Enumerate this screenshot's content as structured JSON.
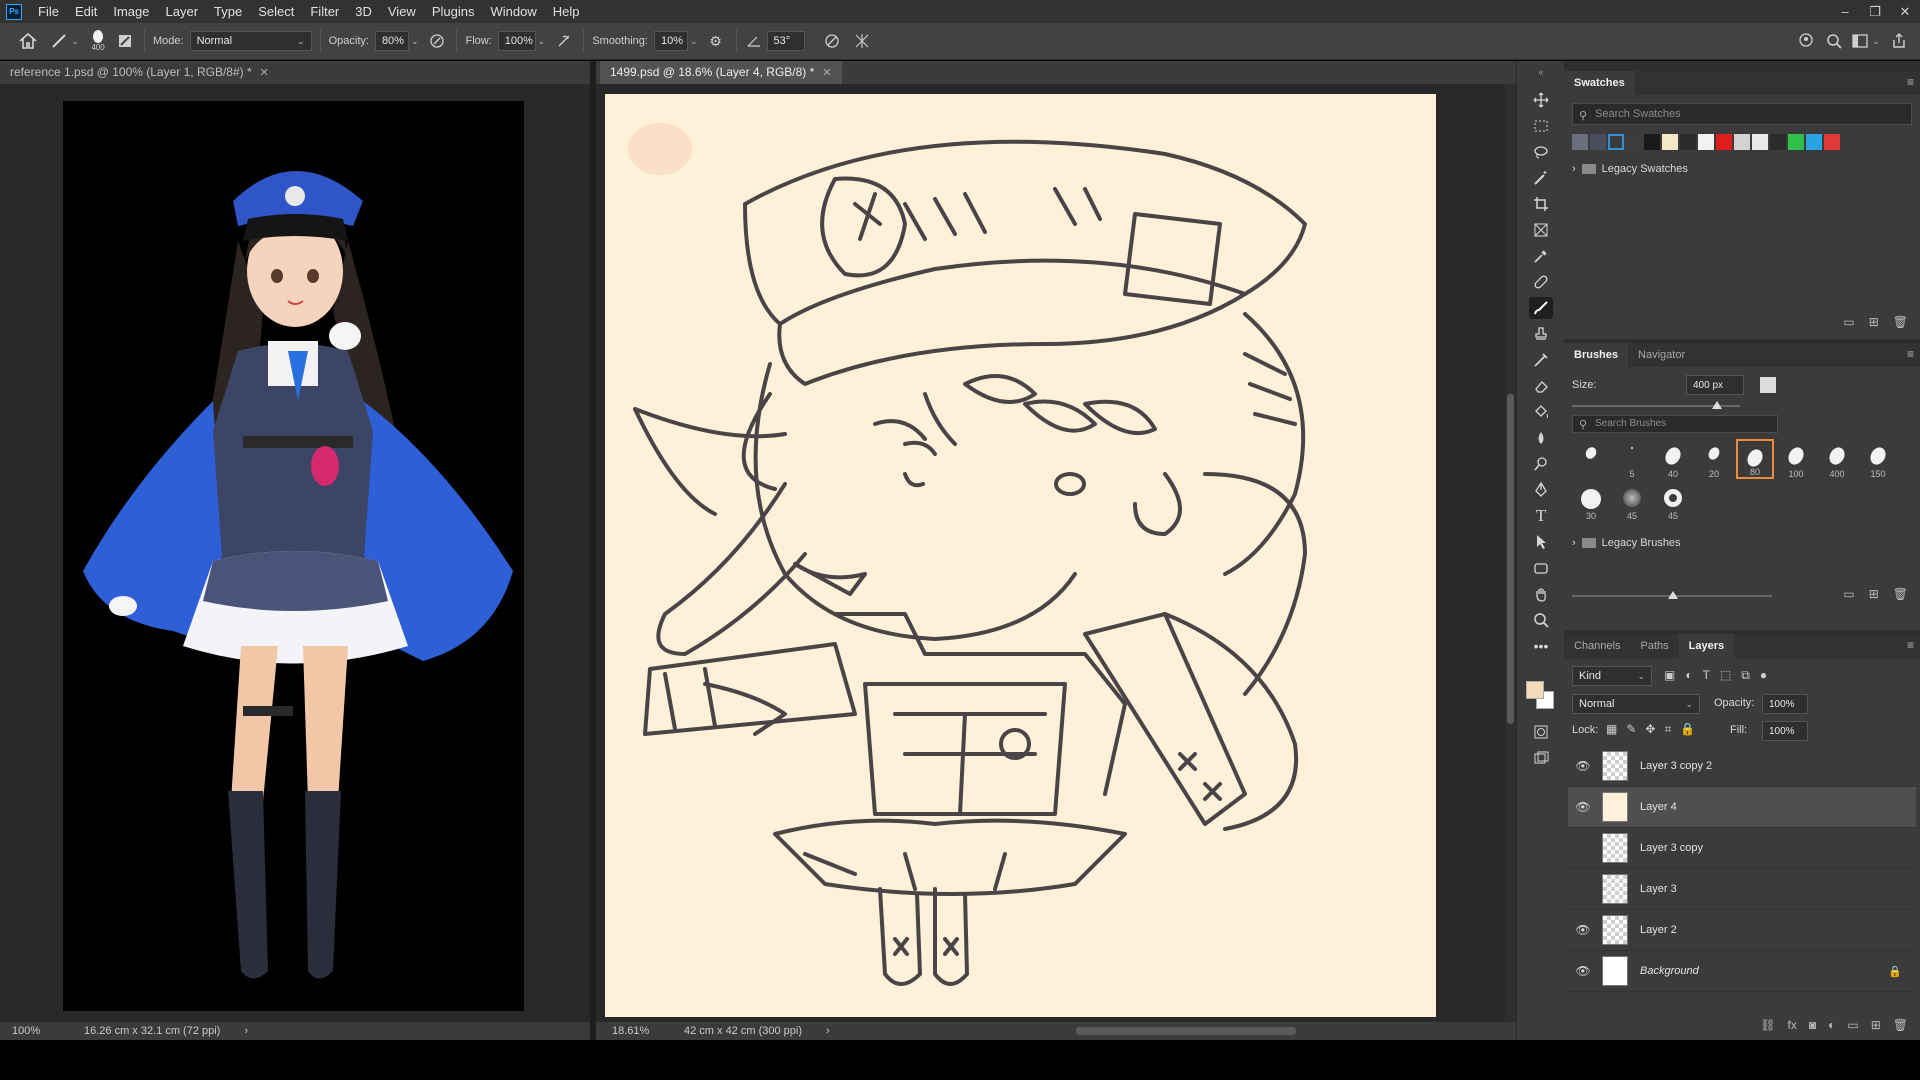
{
  "menubar": {
    "logo": "Ps",
    "items": [
      "File",
      "Edit",
      "Image",
      "Layer",
      "Type",
      "Select",
      "Filter",
      "3D",
      "View",
      "Plugins",
      "Window",
      "Help"
    ]
  },
  "options": {
    "brush_size": "400",
    "mode_label": "Mode:",
    "mode_value": "Normal",
    "opacity_label": "Opacity:",
    "opacity_value": "80%",
    "flow_label": "Flow:",
    "flow_value": "100%",
    "smoothing_label": "Smoothing:",
    "smoothing_value": "10%",
    "angle_value": "53°"
  },
  "documents": {
    "left_tab": "reference 1.psd @ 100% (Layer 1, RGB/8#) *",
    "right_tab": "1499.psd @ 18.6% (Layer 4, RGB/8) *",
    "left_zoom": "100%",
    "left_size": "16.26 cm x 32.1 cm (72 ppi)",
    "right_zoom": "18.61%",
    "right_size": "42 cm x 42 cm (300 ppi)",
    "status_arrow": "›"
  },
  "swatches": {
    "tab": "Swatches",
    "search_placeholder": "Search Swatches",
    "colors": [
      "#6b6f7d",
      "#4a4d5c",
      "#2c91d6",
      "#3c3c3c",
      "#1a1a1a",
      "#f4e8c8",
      "#2b2b2b",
      "#f2f2f2",
      "#e01c1c",
      "#d2d2d2",
      "#e8e8e8",
      "#2b2b2b",
      "#2fc04a",
      "#2aa4e0",
      "#e23a3a"
    ],
    "folder": "Legacy Swatches"
  },
  "brushes": {
    "tabs": [
      "Brushes",
      "Navigator"
    ],
    "size_label": "Size:",
    "size_value": "400 px",
    "search_placeholder": "Search Brushes",
    "tips": [
      {
        "num": ""
      },
      {
        "num": "5"
      },
      {
        "num": "40"
      },
      {
        "num": "20"
      },
      {
        "num": "80"
      },
      {
        "num": "100"
      },
      {
        "num": "400"
      },
      {
        "num": "150"
      },
      {
        "num": "30"
      },
      {
        "num": "45"
      },
      {
        "num": "45"
      }
    ],
    "selected_index": 4,
    "folder": "Legacy Brushes"
  },
  "layers_panel": {
    "tabs": [
      "Channels",
      "Paths",
      "Layers"
    ],
    "kind_label": "Kind",
    "blend_mode": "Normal",
    "opacity_label": "Opacity:",
    "opacity_value": "100%",
    "lock_label": "Lock:",
    "fill_label": "Fill:",
    "fill_value": "100%",
    "layers": [
      {
        "name": "Layer 3 copy 2",
        "visible": true
      },
      {
        "name": "Layer 4",
        "visible": true
      },
      {
        "name": "Layer 3 copy",
        "visible": false
      },
      {
        "name": "Layer 3",
        "visible": false
      },
      {
        "name": "Layer 2",
        "visible": true
      },
      {
        "name": "Background",
        "visible": true
      }
    ]
  },
  "colors": {
    "foreground": "#f5dcb8",
    "background": "#ffffff",
    "canvas_paper": "#fff0d9",
    "accent": "#f08a3c"
  }
}
